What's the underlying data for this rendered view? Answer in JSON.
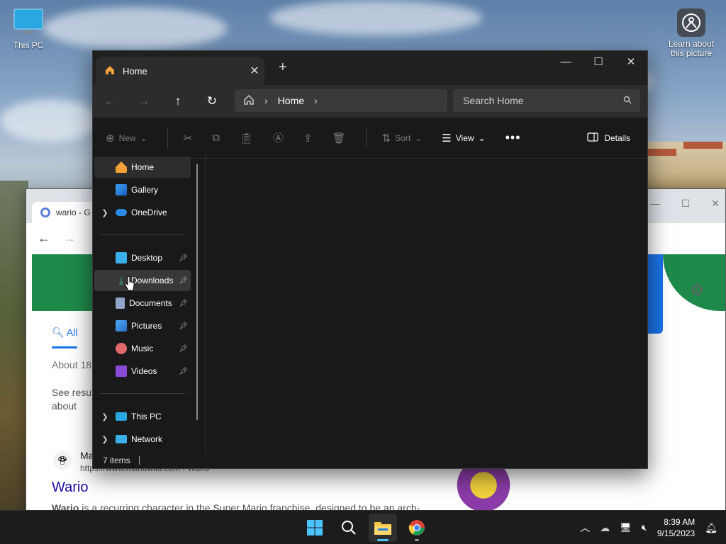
{
  "desktop": {
    "icons": [
      {
        "label": "This PC",
        "icon": "monitor-icon"
      },
      {
        "label": "Learn about\nthis picture",
        "icon": "camera-icon"
      }
    ]
  },
  "chrome": {
    "tab_title": "wario - G",
    "all_tab": "All",
    "about_text": "About 18.",
    "see_results": "See resul about",
    "result_site": "Ma",
    "result_url": "https://www.mariowiki.com › Wario",
    "result_title": "Wario",
    "result_snippet_bold": "Wario",
    "result_snippet": " is a recurring character in the Super Mario franchise, designed to be an arch-"
  },
  "explorer": {
    "tab_label": "Home",
    "address": {
      "crumb": "Home"
    },
    "search_placeholder": "Search Home",
    "commands": {
      "new": "New",
      "sort": "Sort",
      "view": "View",
      "details": "Details"
    },
    "sidebar": {
      "items": [
        {
          "label": "Home"
        },
        {
          "label": "Gallery"
        },
        {
          "label": "OneDrive"
        },
        {
          "label": "Desktop"
        },
        {
          "label": "Downloads"
        },
        {
          "label": "Documents"
        },
        {
          "label": "Pictures"
        },
        {
          "label": "Music"
        },
        {
          "label": "Videos"
        },
        {
          "label": "This PC"
        },
        {
          "label": "Network"
        }
      ]
    },
    "status": "7 items"
  },
  "taskbar": {
    "time": "8:39 AM",
    "date": "9/15/2023"
  },
  "colors": {
    "accent": "#4cc2ff",
    "explorer_bg": "#191919",
    "taskbar_bg": "#1c1c1c"
  }
}
